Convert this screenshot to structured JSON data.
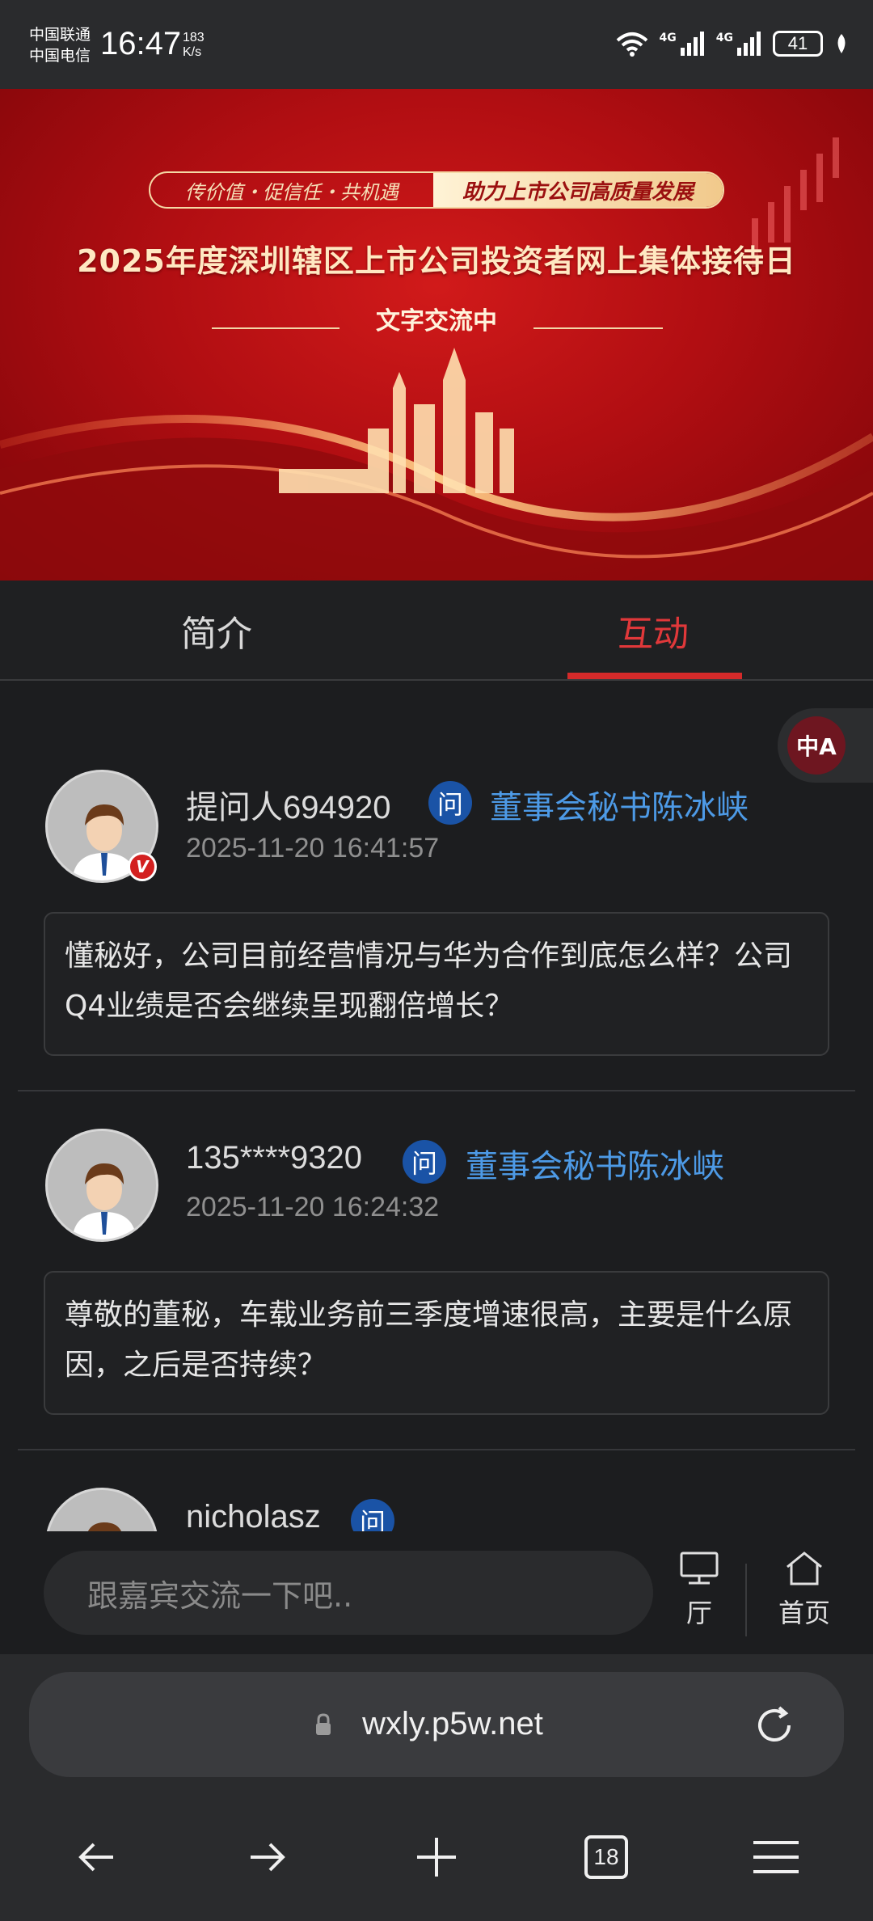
{
  "status_bar": {
    "carrier1": "中国联通",
    "carrier2": "中国电信",
    "time": "16:47",
    "net_speed_value": "183",
    "net_speed_unit": "K/s",
    "network1": "4G",
    "network2": "4G",
    "battery": "41"
  },
  "banner": {
    "slogan_left": "传价值・促信任・共机遇",
    "slogan_right": "助力上市公司高质量发展",
    "title": "2025年度深圳辖区上市公司投资者网上集体接待日",
    "subtitle": "文字交流中"
  },
  "tabs": [
    {
      "label": "简介",
      "active": false
    },
    {
      "label": "互动",
      "active": true
    }
  ],
  "translate_button": {
    "label": "中A"
  },
  "questions": [
    {
      "asker": "提问人694920",
      "q_icon": "问",
      "target": "董事会秘书陈冰峡",
      "time": "2025-11-20 16:41:57",
      "verified_badge": "V",
      "content": "懂秘好，公司目前经营情况与华为合作到底怎么样？公司Q4业绩是否会继续呈现翻倍增长？"
    },
    {
      "asker": "135****9320",
      "q_icon": "问",
      "target": "董事会秘书陈冰峡",
      "time": "2025-11-20 16:24:32",
      "content": "尊敬的董秘，车载业务前三季度增速很高，主要是什么原因，之后是否持续？"
    },
    {
      "asker": "nicholasz",
      "q_icon": "问"
    }
  ],
  "comment_bar": {
    "placeholder": "跟嘉宾交流一下吧..",
    "hall_label": "厅",
    "home_label": "首页"
  },
  "browser": {
    "url": "wxly.p5w.net",
    "tab_count": "18"
  },
  "colors": {
    "accent_red": "#d42a2a",
    "link_blue": "#4d9ae6",
    "question_icon_blue": "#1a53a6"
  }
}
